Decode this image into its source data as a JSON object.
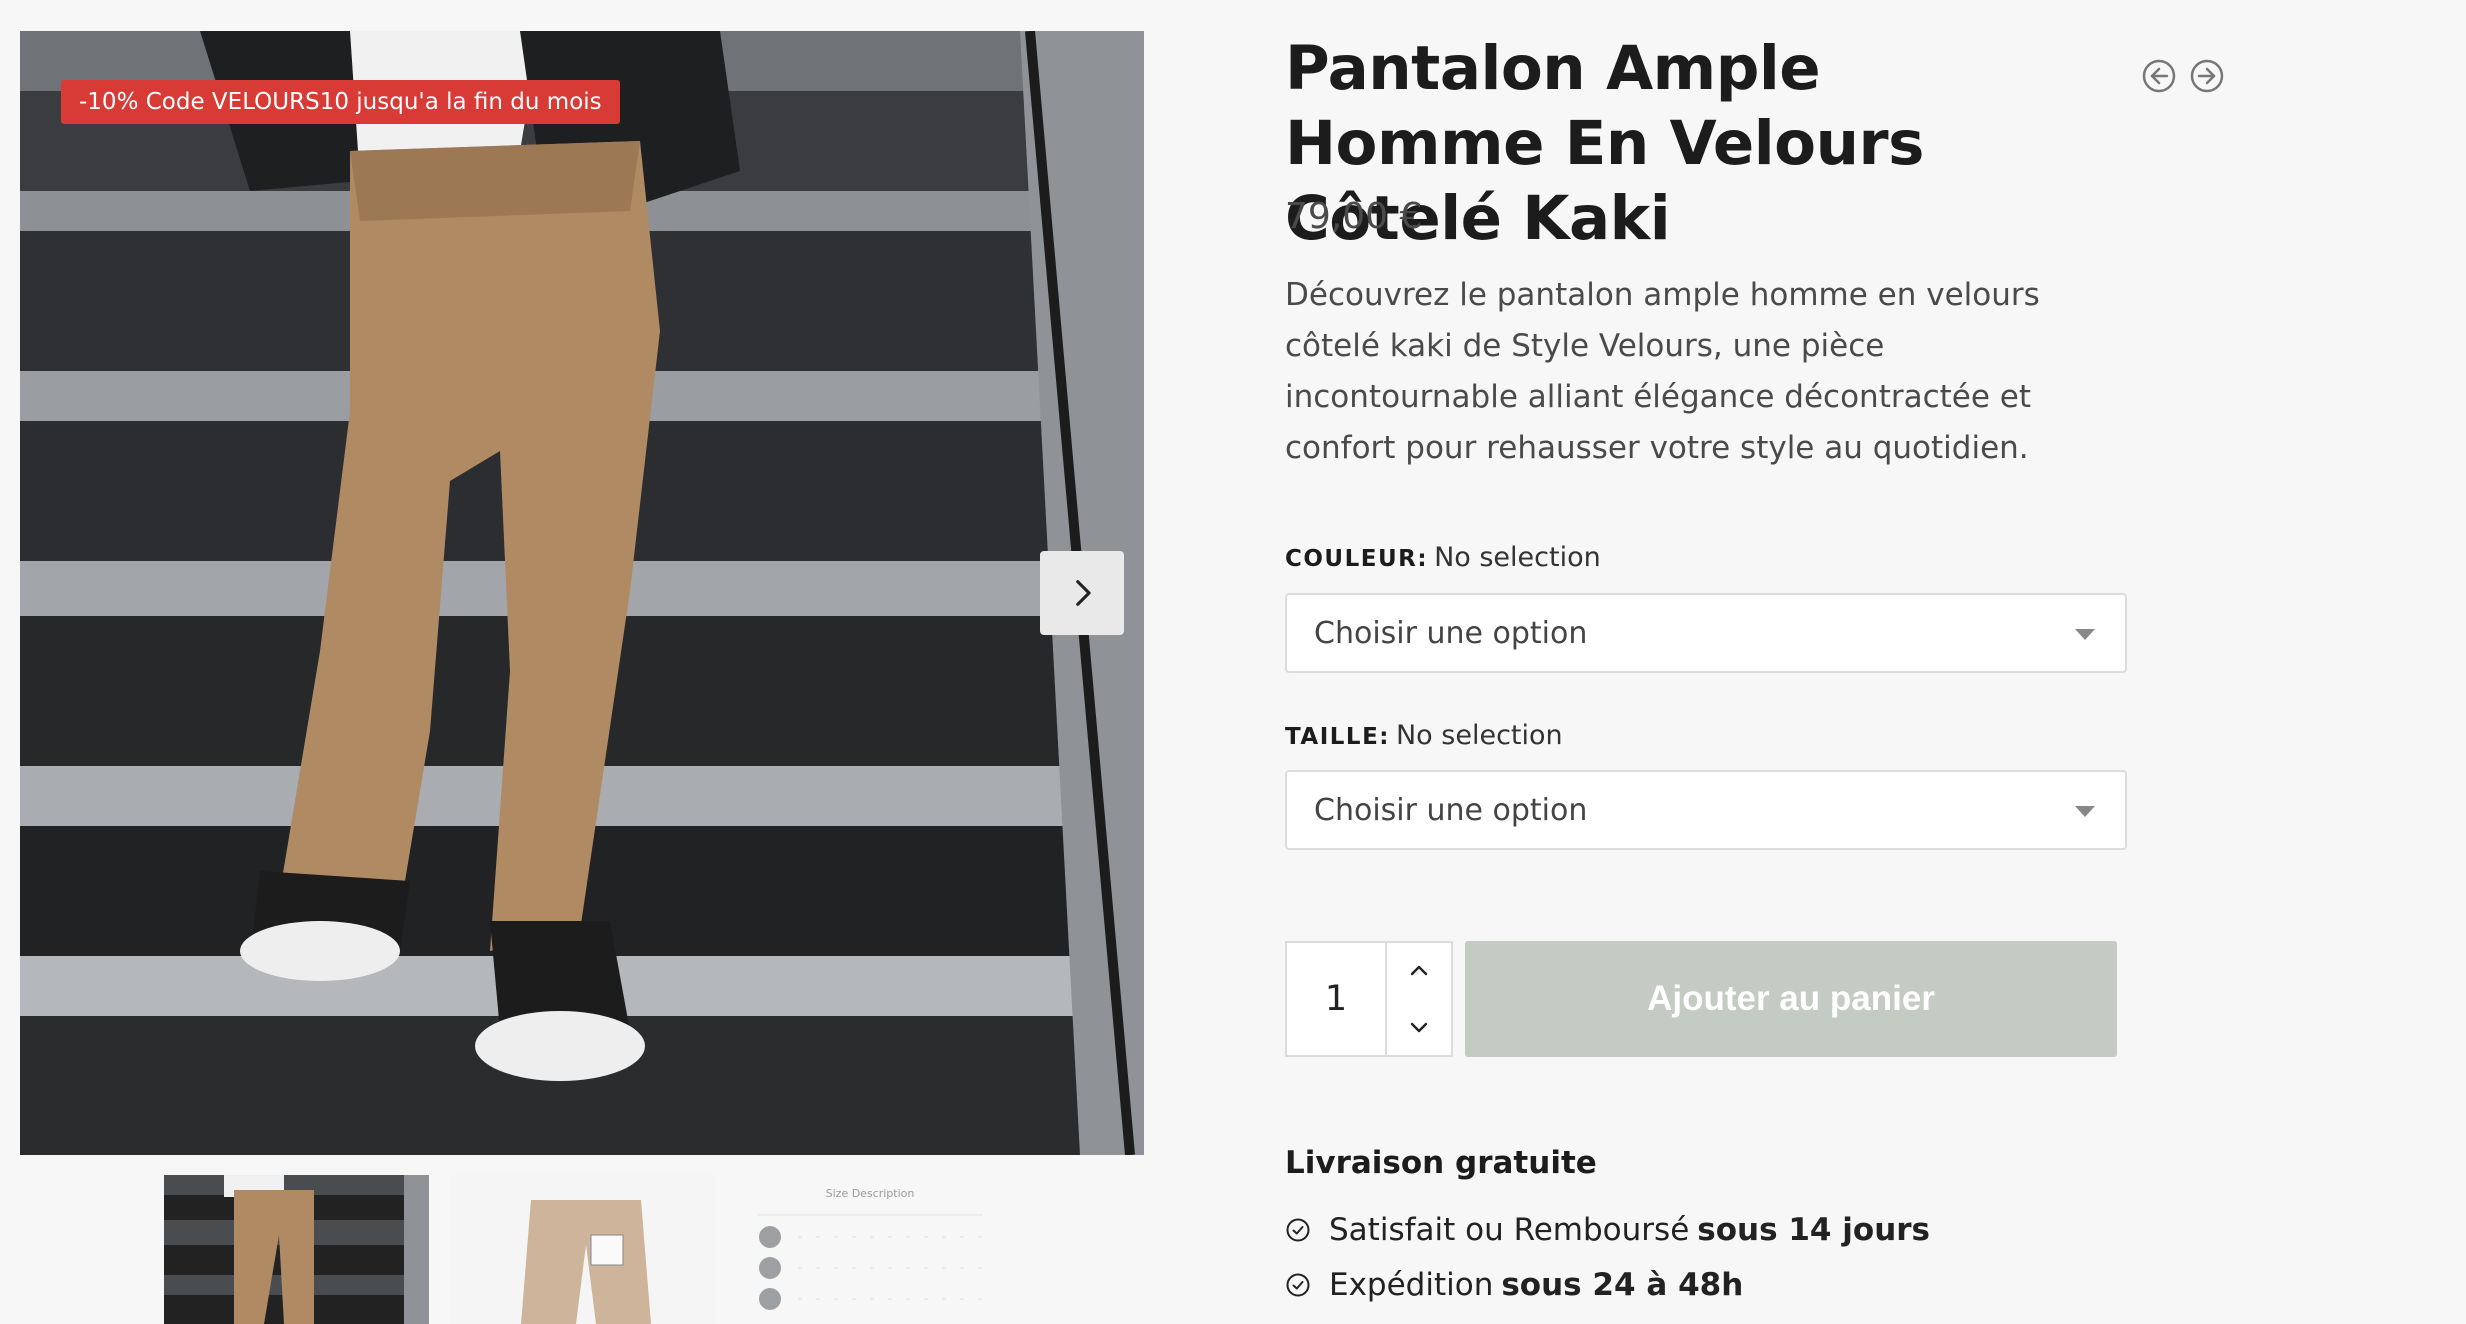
{
  "gallery": {
    "promo_badge": "-10% Code VELOURS10 jusqu'a la fin du mois",
    "next_icon": "chevron-right-icon",
    "thumbnails": [
      {
        "name": "thumbnail-model-stairs"
      },
      {
        "name": "thumbnail-pants-flat"
      },
      {
        "name": "thumbnail-size-chart",
        "title": "Size Description"
      }
    ]
  },
  "product": {
    "title": "Pantalon Ample Homme En Velours Côtelé Kaki",
    "price": "79,00 €",
    "description": "Découvrez le pantalon ample homme en velours côtelé kaki de Style Velours, une pièce incontournable alliant élégance décontractée et confort pour rehausser votre style au quotidien."
  },
  "nav": {
    "prev_icon": "arrow-left-circle-icon",
    "next_icon": "arrow-right-circle-icon"
  },
  "options": {
    "color": {
      "label": "COULEUR:",
      "value": "No selection",
      "placeholder": "Choisir une option"
    },
    "size": {
      "label": "TAILLE:",
      "value": "No selection",
      "placeholder": "Choisir une option"
    }
  },
  "cart": {
    "quantity": "1",
    "add_label": "Ajouter au panier",
    "button_color": "#c3cbc3"
  },
  "shipping": {
    "title": "Livraison gratuite",
    "features": [
      {
        "text": "Satisfait ou Remboursé",
        "bold": "sous 14 jours"
      },
      {
        "text": "Expédition",
        "bold": "sous 24 à 48h"
      }
    ]
  },
  "colors": {
    "promo": "#d83a36",
    "background": "#f7f7f7",
    "pants": "#b08a63"
  }
}
